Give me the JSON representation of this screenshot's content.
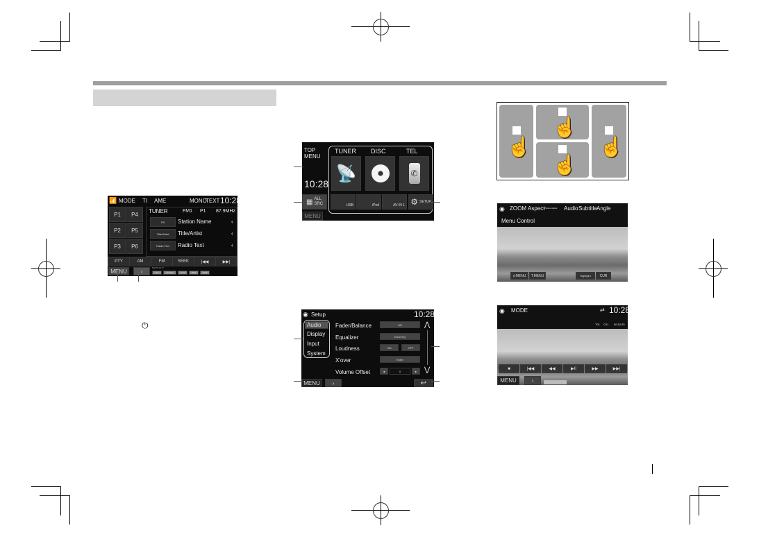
{
  "page": {
    "footer_mark": "|"
  },
  "tuner_screen": {
    "status_bar": {
      "mode": "MODE",
      "ti": "TI",
      "ame": "AME",
      "mono": "MONO",
      "text": "TEXT",
      "clock": "10:28"
    },
    "presets": [
      "P1",
      "P4",
      "P2",
      "P5",
      "P3",
      "P6"
    ],
    "header": {
      "source": "TUNER",
      "band": "FM1",
      "preset": "P1",
      "frequency": "87.9MHz"
    },
    "rows": [
      {
        "tag": "PS",
        "value": "Station Name"
      },
      {
        "tag": "Title/Artist",
        "value": "Title/Artist"
      },
      {
        "tag": "Radio Text",
        "value": "Radio Text"
      }
    ],
    "bottom_buttons": [
      "PTY",
      "AM",
      "FM",
      "SEEK",
      "|◀◀",
      "▶▶|"
    ],
    "menu_label": "MENU",
    "next_label": "›",
    "indicators_top": "NEWS  AF  TI",
    "indicators": [
      "ST",
      "AUTO1",
      "LO.S",
      "RDS",
      "EON"
    ]
  },
  "power_icon": "⏻",
  "top_menu_screen": {
    "title_line1": "TOP",
    "title_line2": "MENU",
    "clock": "10:28",
    "sources": [
      {
        "label": "TUNER",
        "icon": "antenna-tower-icon"
      },
      {
        "label": "DISC",
        "icon": "disc-icon"
      },
      {
        "label": "TEL",
        "icon": "phone-icon"
      }
    ],
    "all_src_line1": "ALL",
    "all_src_line2": "SRC",
    "small_sources": [
      "USB",
      "iPod",
      "AV-IN 1"
    ],
    "setup_label": "SETUP",
    "menu_label": "MENU"
  },
  "setup_screen": {
    "title": "Setup",
    "clock": "10:28",
    "categories": [
      "Audio",
      "Display",
      "Input",
      "System"
    ],
    "selected_category": "Audio",
    "items": [
      {
        "label": "Fader/Balance",
        "buttons": [
          "0/0"
        ]
      },
      {
        "label": "Equalizer",
        "buttons": [
          "Drive EQ"
        ]
      },
      {
        "label": "Loudness",
        "buttons": [
          "ON",
          "OFF"
        ]
      },
      {
        "label": "X'over",
        "buttons": [
          "Enter"
        ]
      },
      {
        "label": "Volume Offset",
        "buttons": [
          "◄",
          "0",
          "►"
        ]
      }
    ],
    "scroll_up": "⋀",
    "scroll_down": "⋁",
    "menu_label": "MENU",
    "next_label": "›",
    "back_label": "↩"
  },
  "touch_zones": {
    "hand_glyph": "☝"
  },
  "dvd_menu_screen": {
    "tabs": [
      "ZOOM",
      "Aspect",
      "Picture Adjust",
      "Audio",
      "Subtitle",
      "Angle"
    ],
    "menu_control": "Menu Control",
    "bottom_buttons": [
      "⊙MENU",
      "T.MENU",
      "Highlight",
      "CUR"
    ]
  },
  "dvd_playback_screen": {
    "mode": "MODE",
    "repeat_icon": "⇄",
    "clock": "10:28",
    "track_info": {
      "title": "T01",
      "chapter": "C01",
      "time": "00:10:25"
    },
    "controls": [
      "■",
      "|◀◀",
      "◀◀",
      "▶II",
      "▶▶",
      "▶▶|"
    ],
    "menu_label": "MENU",
    "next_label": "›"
  }
}
